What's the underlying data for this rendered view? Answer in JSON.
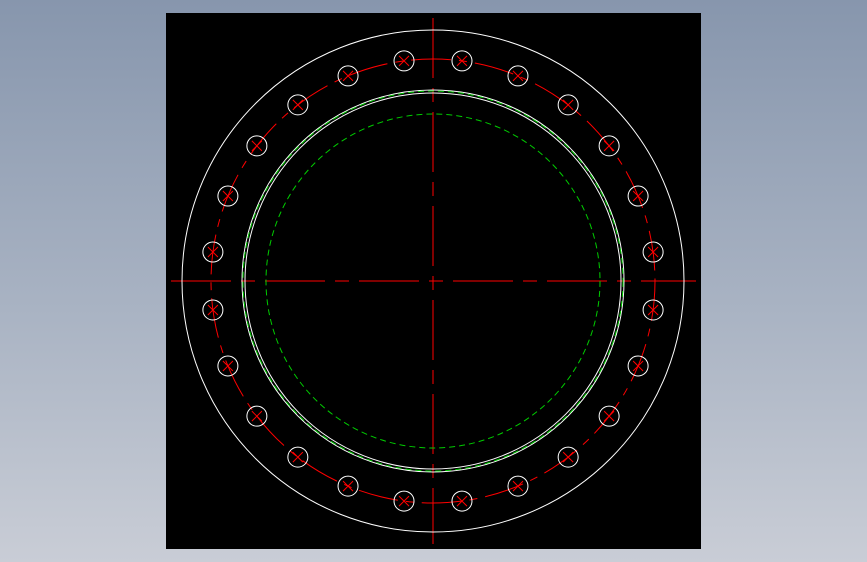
{
  "drawing": {
    "title": "",
    "viewport_background": "#000000",
    "bolt_hole_count": 24,
    "colors": {
      "outline": "#ffffff",
      "centerline": "#ff0000",
      "hidden_line": "#00cc00"
    }
  }
}
